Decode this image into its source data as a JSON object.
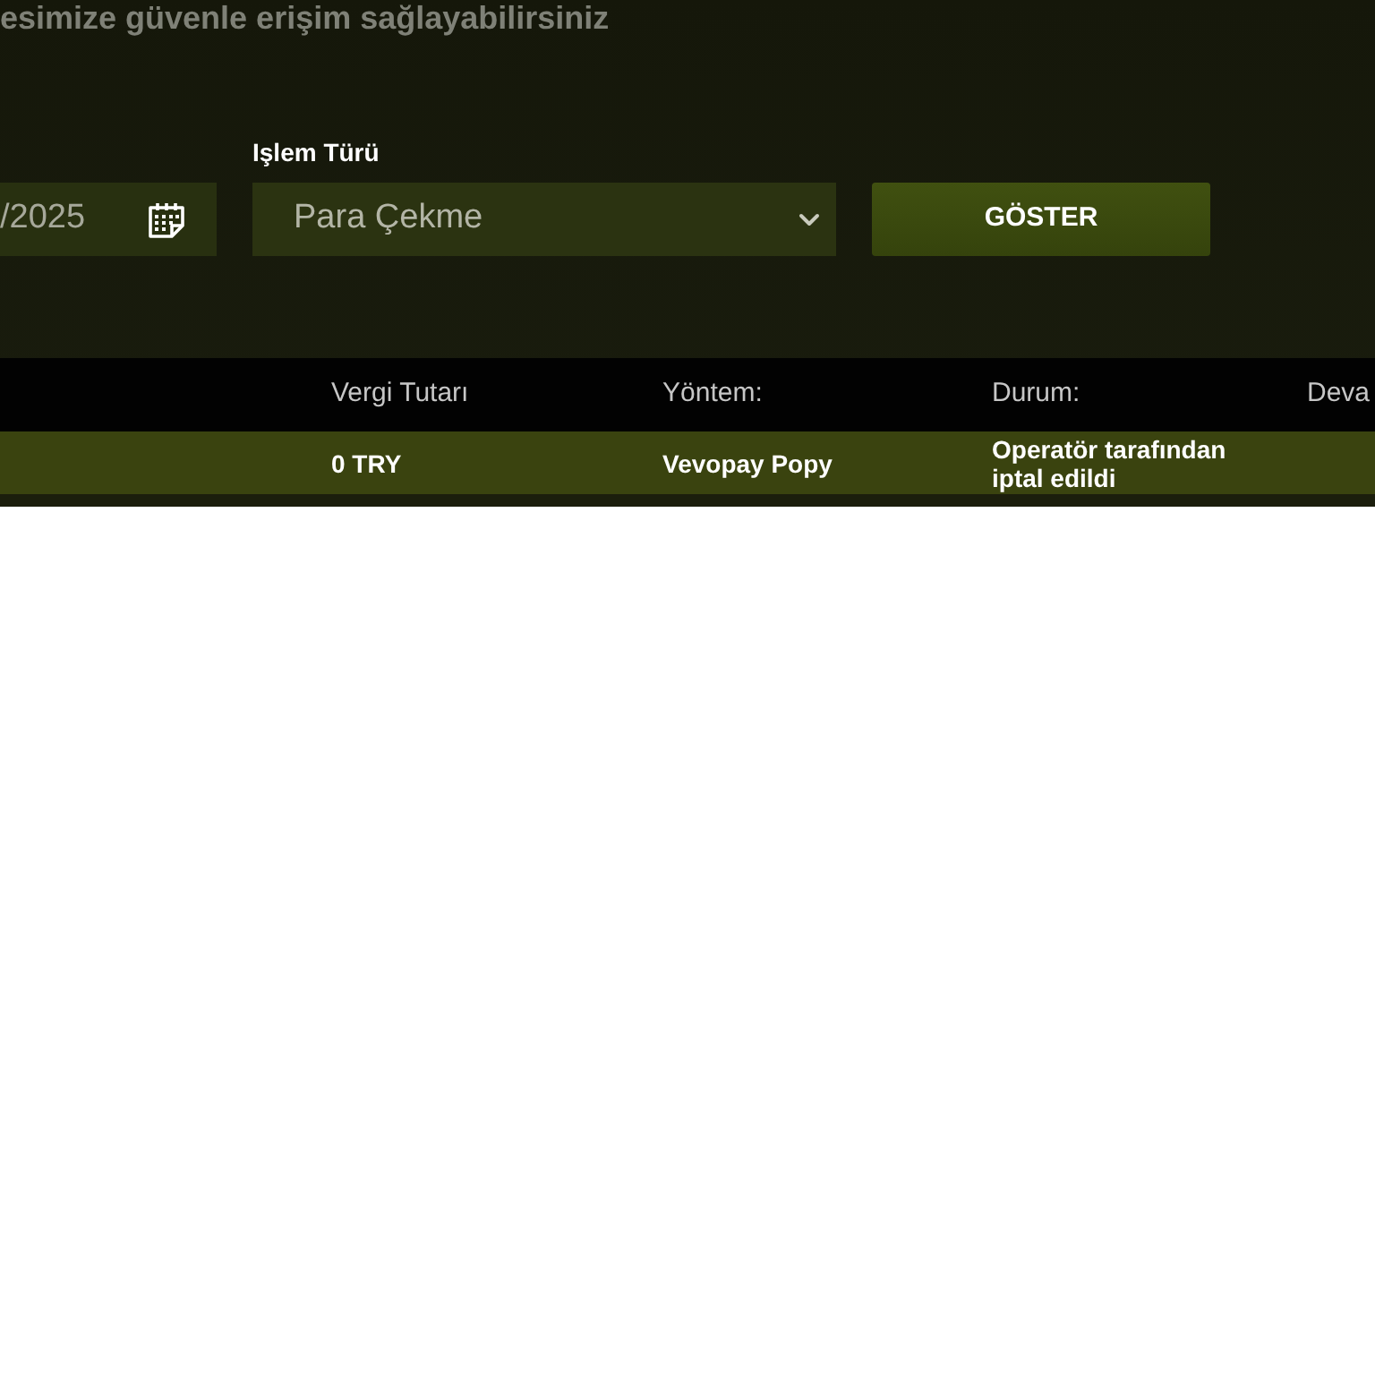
{
  "intro_text": "esimize güvenle erişim sağlayabilirsiniz",
  "filters": {
    "date_field": {
      "value": "/2025"
    },
    "transaction_type": {
      "label": "Işlem Türü",
      "value": "Para Çekme"
    },
    "show_button": "GÖSTER"
  },
  "table": {
    "columns": [
      "Vergi Tutarı",
      "Yöntem:",
      "Durum:",
      "Deva"
    ],
    "rows": [
      [
        "0 TRY",
        "Vevopay Popy",
        "Operatör tarafından iptal edildi"
      ]
    ]
  }
}
